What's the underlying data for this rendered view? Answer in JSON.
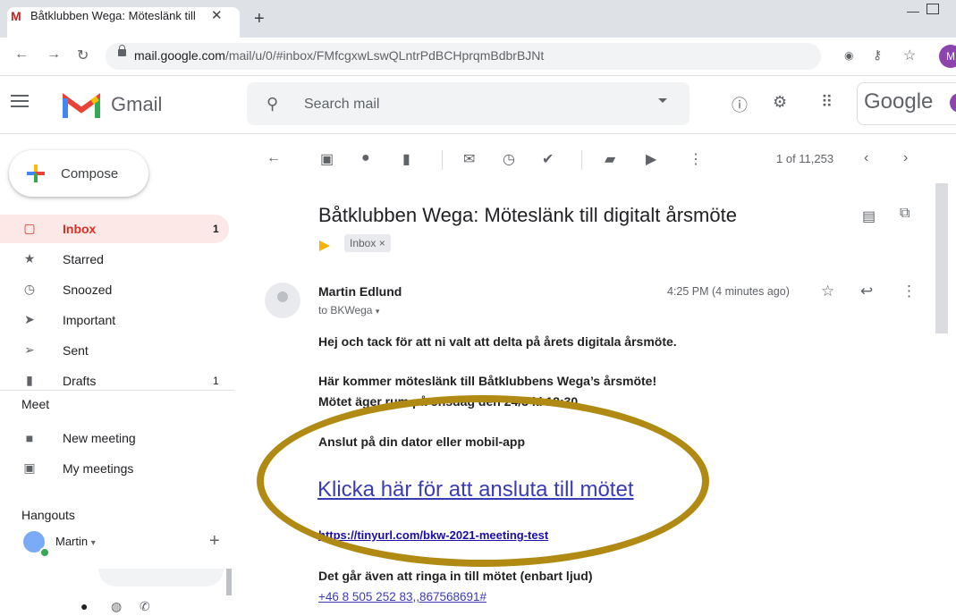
{
  "browser": {
    "tab_title": "Båtklubben Wega: Möteslänk till",
    "tab_close": "✕",
    "new_tab": "+",
    "url_domain": "mail.google.com",
    "url_path": "/mail/u/0/#inbox/FMfcgxwLswQLntrPdBCHprqmBdbrBJNt",
    "profile_initial": "M"
  },
  "gmail": {
    "brand": "Gmail",
    "search_placeholder": "Search mail",
    "account_brand": "Google"
  },
  "sidebar": {
    "compose_label": "Compose",
    "items": [
      {
        "label": "Inbox",
        "count": "1",
        "icon": "inbox-icon"
      },
      {
        "label": "Starred",
        "count": "",
        "icon": "star-icon"
      },
      {
        "label": "Snoozed",
        "count": "",
        "icon": "clock-icon"
      },
      {
        "label": "Important",
        "count": "",
        "icon": "important-icon"
      },
      {
        "label": "Sent",
        "count": "",
        "icon": "send-icon"
      },
      {
        "label": "Drafts",
        "count": "1",
        "icon": "draft-icon"
      }
    ],
    "meet": {
      "heading": "Meet",
      "new_meeting": "New meeting",
      "my_meetings": "My meetings"
    },
    "hangouts": {
      "heading": "Hangouts",
      "user": "Martin",
      "add": "+"
    }
  },
  "toolbar": {
    "pager_text": "1 of 11,253"
  },
  "message": {
    "subject": "Båtklubben Wega: Möteslänk till digitalt årsmöte",
    "label": "Inbox",
    "label_remove": "×",
    "sender": "Martin Edlund",
    "to": "to BKWega",
    "time": "4:25 PM (4 minutes ago)",
    "body": {
      "line1": "Hej och tack för att ni valt att delta på årets digitala årsmöte.",
      "line2": "Här kommer möteslänk till Båtklubbens Wega’s årsmöte!",
      "line3": "Mötet äger rum på onsdag den 24/3 kl 18:30",
      "line4": "Anslut på din dator eller mobil-app",
      "join_link": "Klicka här för att ansluta till mötet",
      "short_url": "https://tinyurl.com/bkw-2021-meeting-test",
      "dial_in": "Det går även att ringa in till mötet (enbart ljud)",
      "phone": "+46 8 505 252 83,,867568691#"
    }
  },
  "colors": {
    "accent_red": "#d93025",
    "highlight_oval": "#b08a12",
    "link": "#3b3bb8"
  }
}
